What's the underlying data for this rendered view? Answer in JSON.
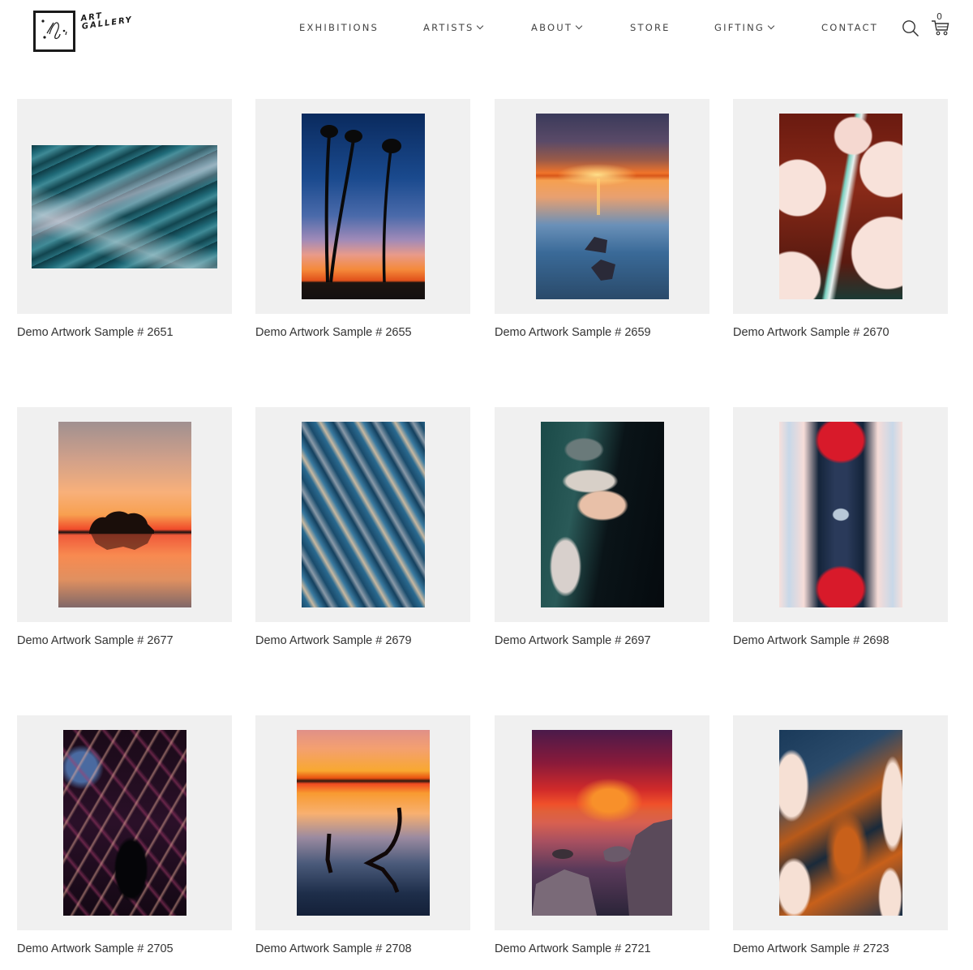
{
  "header": {
    "logo_text_line1": "ART",
    "logo_text_line2": "GALLERY",
    "nav": [
      {
        "label": "EXHIBITIONS",
        "has_dropdown": false
      },
      {
        "label": "ARTISTS",
        "has_dropdown": true
      },
      {
        "label": "ABOUT",
        "has_dropdown": true
      },
      {
        "label": "STORE",
        "has_dropdown": false
      },
      {
        "label": "GIFTING",
        "has_dropdown": true
      },
      {
        "label": "CONTACT",
        "has_dropdown": false
      }
    ],
    "search_icon": "search-icon",
    "cart_icon": "cart-icon",
    "cart_count": "0"
  },
  "artworks": [
    {
      "title": "Demo Artwork Sample # 2651",
      "theme": "teal-marble-abstract"
    },
    {
      "title": "Demo Artwork Sample # 2655",
      "theme": "palm-trees-sunset"
    },
    {
      "title": "Demo Artwork Sample # 2659",
      "theme": "lake-sunset-rocks"
    },
    {
      "title": "Demo Artwork Sample # 2670",
      "theme": "red-white-cells-abstract"
    },
    {
      "title": "Demo Artwork Sample # 2677",
      "theme": "island-trees-sunset"
    },
    {
      "title": "Demo Artwork Sample # 2679",
      "theme": "blue-beige-swirl-abstract"
    },
    {
      "title": "Demo Artwork Sample # 2697",
      "theme": "dark-cells-abstract"
    },
    {
      "title": "Demo Artwork Sample # 2698",
      "theme": "red-navy-symmetric-abstract"
    },
    {
      "title": "Demo Artwork Sample # 2705",
      "theme": "purple-dark-fluid-abstract"
    },
    {
      "title": "Demo Artwork Sample # 2708",
      "theme": "driftwood-sunset-lake"
    },
    {
      "title": "Demo Artwork Sample # 2721",
      "theme": "red-sky-rocky-shore"
    },
    {
      "title": "Demo Artwork Sample # 2723",
      "theme": "orange-blue-cells-abstract"
    }
  ]
}
